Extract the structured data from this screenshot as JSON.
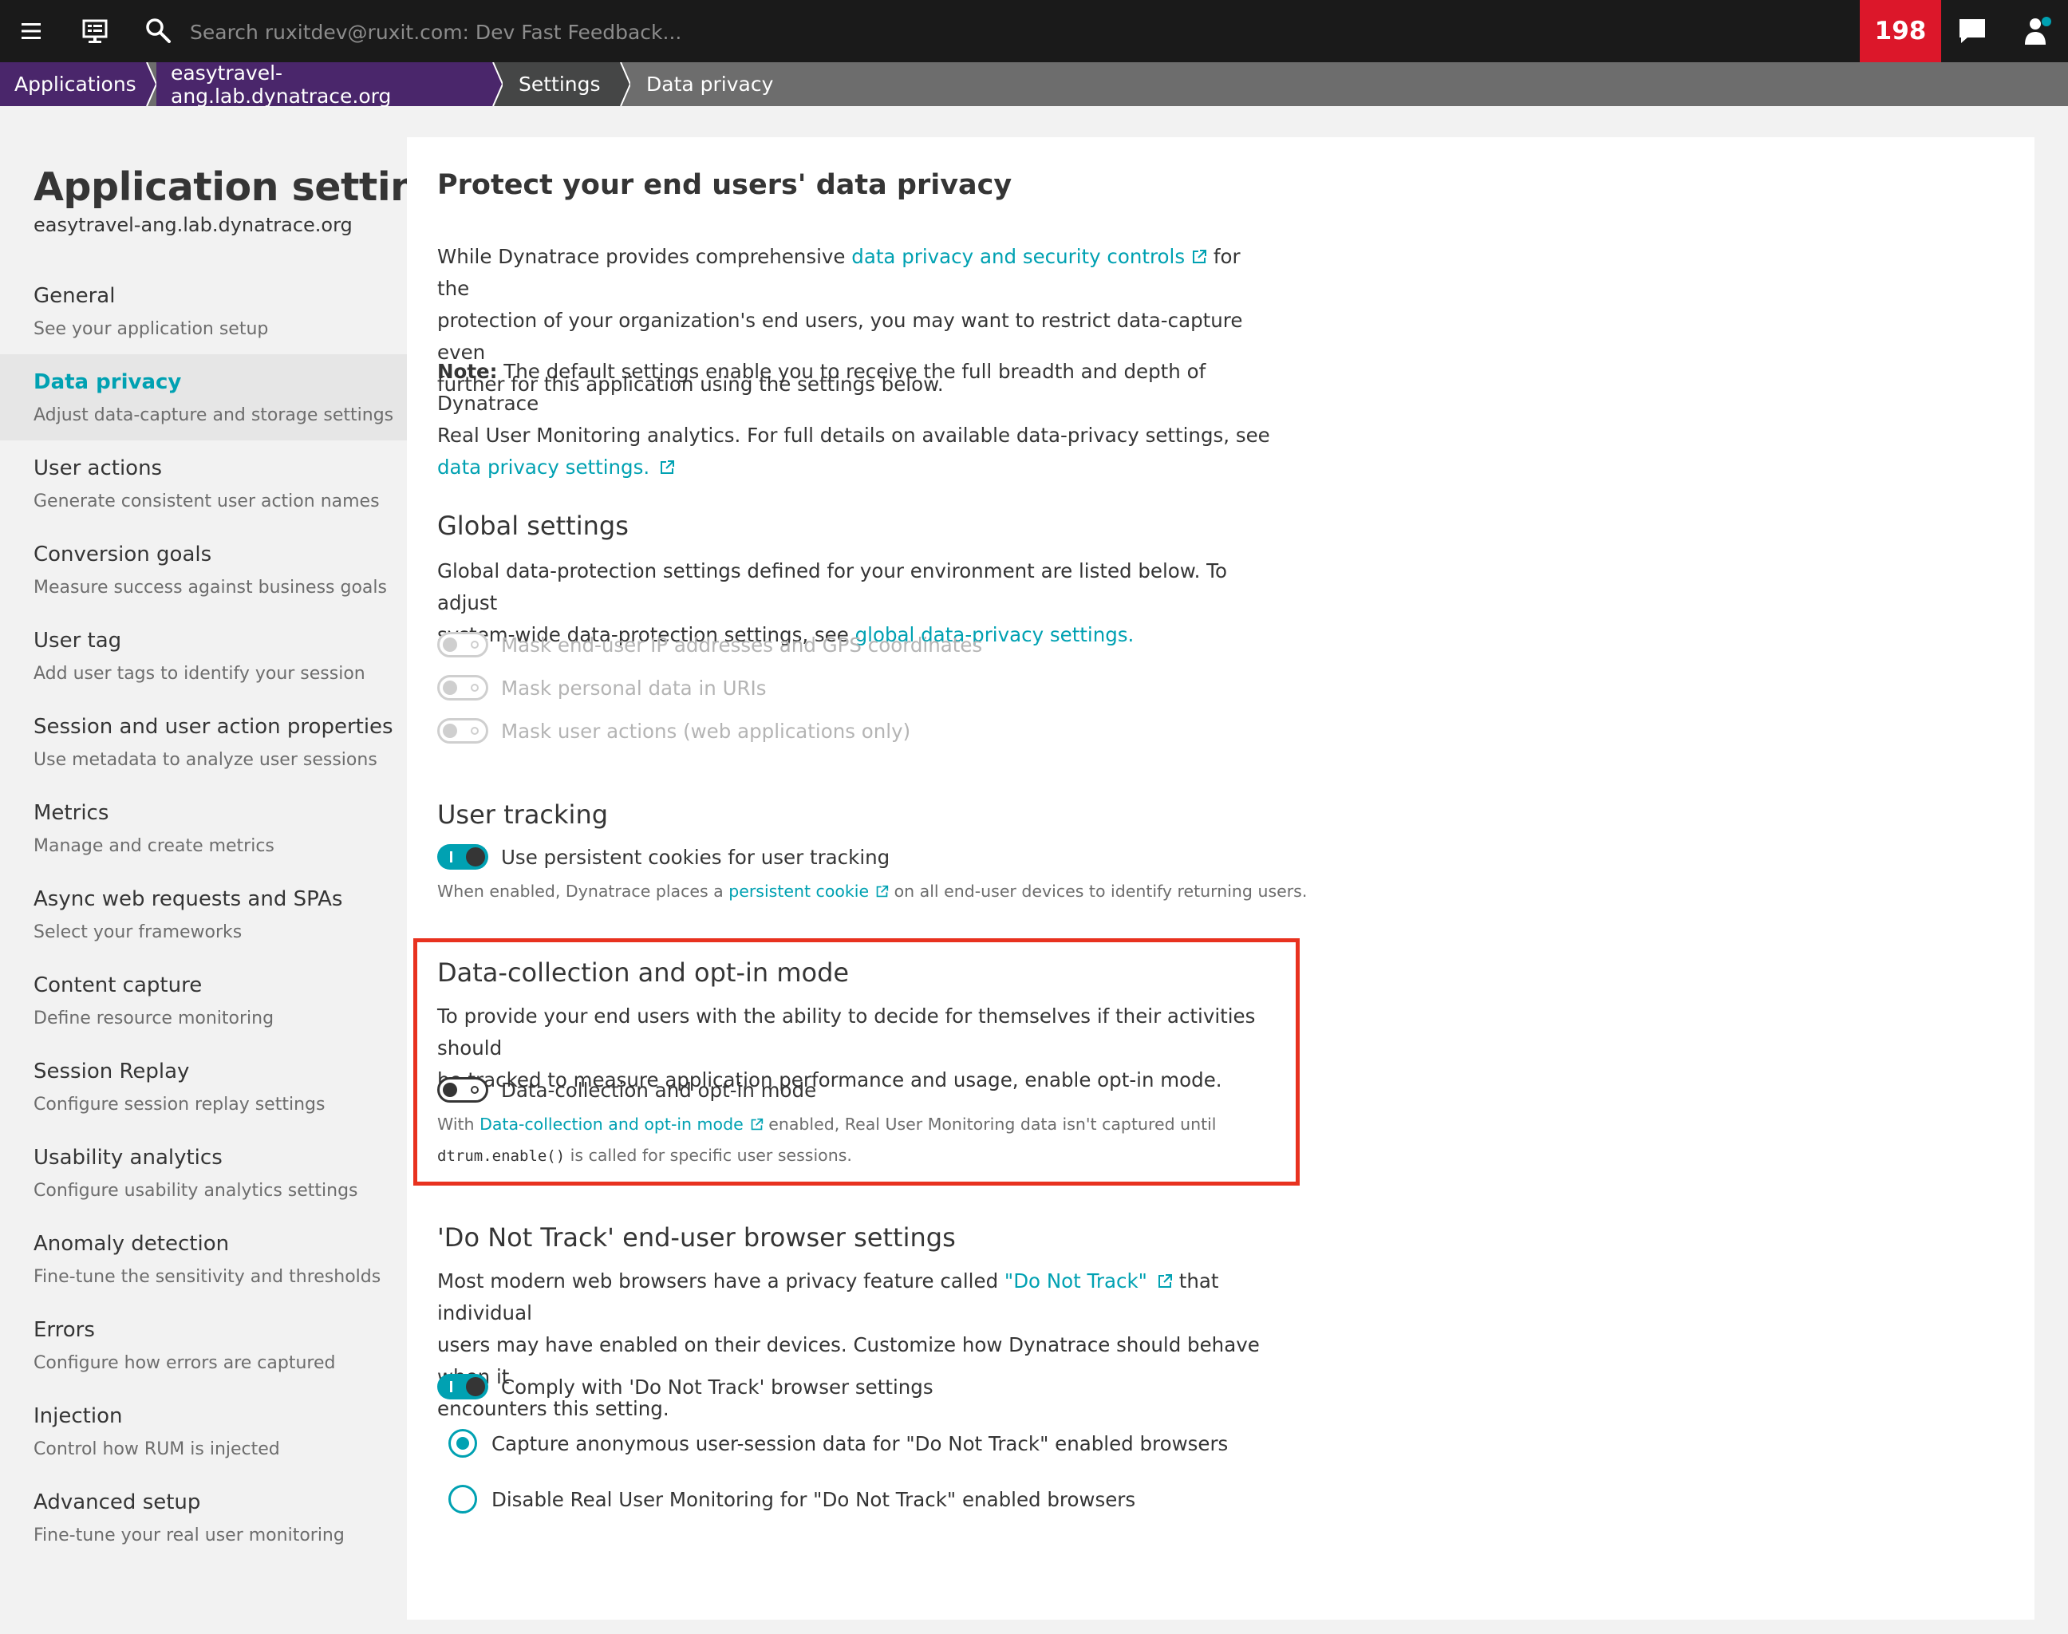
{
  "topbar": {
    "search_placeholder": "Search ruxitdev@ruxit.com: Dev Fast Feedback...",
    "problems_count": "198"
  },
  "breadcrumb": [
    "Applications",
    "easytravel-ang.lab.dynatrace.org",
    "Settings",
    "Data privacy"
  ],
  "sidebar": {
    "title": "Application settings",
    "subtitle": "easytravel-ang.lab.dynatrace.org",
    "items": [
      {
        "label": "General",
        "desc": "See your application setup",
        "active": false
      },
      {
        "label": "Data privacy",
        "desc": "Adjust data-capture and storage settings",
        "active": true
      },
      {
        "label": "User actions",
        "desc": "Generate consistent user action names",
        "active": false
      },
      {
        "label": "Conversion goals",
        "desc": "Measure success against business goals",
        "active": false
      },
      {
        "label": "User tag",
        "desc": "Add user tags to identify your session",
        "active": false
      },
      {
        "label": "Session and user action properties",
        "desc": "Use metadata to analyze user sessions",
        "active": false
      },
      {
        "label": "Metrics",
        "desc": "Manage and create metrics",
        "active": false
      },
      {
        "label": "Async web requests and SPAs",
        "desc": "Select your frameworks",
        "active": false
      },
      {
        "label": "Content capture",
        "desc": "Define resource monitoring",
        "active": false
      },
      {
        "label": "Session Replay",
        "desc": "Configure session replay settings",
        "active": false
      },
      {
        "label": "Usability analytics",
        "desc": "Configure usability analytics settings",
        "active": false
      },
      {
        "label": "Anomaly detection",
        "desc": "Fine-tune the sensitivity and thresholds",
        "active": false
      },
      {
        "label": "Errors",
        "desc": "Configure how errors are captured",
        "active": false
      },
      {
        "label": "Injection",
        "desc": "Control how RUM is injected",
        "active": false
      },
      {
        "label": "Advanced setup",
        "desc": "Fine-tune your real user monitoring",
        "active": false
      }
    ]
  },
  "main": {
    "title": "Protect your end users' data privacy",
    "intro": {
      "before": "While Dynatrace provides comprehensive ",
      "link": "data privacy and security controls",
      "after_1": " for the",
      "line2": "protection of your organization's end users, you may want to restrict data-capture even",
      "line3": "further for this application using the settings below."
    },
    "note": {
      "label": "Note:",
      "line1": " The default settings enable you to receive the full breadth and depth of Dynatrace",
      "line2": "Real User Monitoring analytics. For full details on available data-privacy settings, see",
      "link": "data privacy settings."
    },
    "global": {
      "title": "Global settings",
      "line1": "Global data-protection settings defined for your environment are listed below. To adjust",
      "line2_before": "system-wide data-protection settings, see ",
      "line2_link": "global data-privacy settings.",
      "toggles": [
        "Mask end-user IP addresses and GPS coordinates",
        "Mask personal data in URIs",
        "Mask user actions (web applications only)"
      ]
    },
    "tracking": {
      "title": "User tracking",
      "toggle_label": "Use persistent cookies for user tracking",
      "hint_before": "When enabled, Dynatrace places a ",
      "hint_link": "persistent cookie",
      "hint_after": " on all end-user devices to identify returning users."
    },
    "optin": {
      "title": "Data-collection and opt-in mode",
      "line1": "To provide your end users with the ability to decide for themselves if their activities should",
      "line2": "be tracked to measure application performance and usage, enable opt-in mode.",
      "toggle_label": "Data-collection and opt-in mode",
      "hint_before": "With ",
      "hint_link": "Data-collection and opt-in mode",
      "hint_after": " enabled, Real User Monitoring data isn't captured until",
      "hint_code": "dtrum.enable()",
      "hint_end": " is called for specific user sessions."
    },
    "dnt": {
      "title": "'Do Not Track' end-user browser settings",
      "line1_before": "Most modern web browsers have a privacy feature called ",
      "line1_link": "\"Do Not Track\"",
      "line1_after": " that individual",
      "line2": "users may have enabled on their devices. Customize how Dynatrace should behave when it",
      "line3": "encounters this setting.",
      "toggle_label": "Comply with 'Do Not Track' browser settings",
      "radio1": "Capture anonymous user-session data for \"Do Not Track\" enabled browsers",
      "radio2": "Disable Real User Monitoring for \"Do Not Track\" enabled browsers"
    }
  },
  "colors": {
    "accent": "#00a1b2",
    "topbar": "#1a1a1a",
    "problems": "#dc172a",
    "breadcrumb_app": "#4a266b",
    "highlight": "#e8321f"
  },
  "icons": [
    "menu-icon",
    "monitor-icon",
    "search-icon",
    "chat-icon",
    "user-icon",
    "external-link-icon"
  ]
}
